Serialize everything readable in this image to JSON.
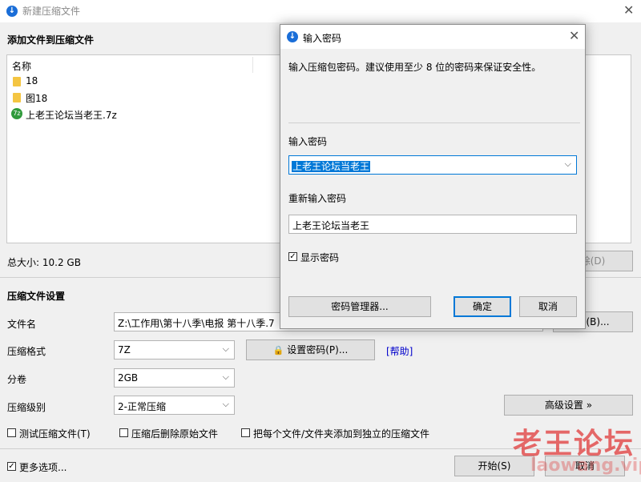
{
  "window": {
    "title": "新建压缩文件",
    "close": "✕"
  },
  "add_section": {
    "title": "添加文件到压缩文件",
    "column_header": "名称",
    "files": [
      {
        "name": "18",
        "icon": "folder-icon"
      },
      {
        "name": "图18",
        "icon": "folder-icon"
      },
      {
        "name": "上老王论坛当老王.7z",
        "icon": "archive-icon"
      }
    ],
    "total_size": "总大小: 10.2 GB",
    "remove_btn": "除(D)"
  },
  "settings": {
    "title": "压缩文件设置",
    "filename_label": "文件名",
    "filename_value": "Z:\\工作用\\第十八季\\电报 第十八季.7",
    "browse_btn": "览(B)...",
    "format_label": "压缩格式",
    "format_value": "7Z",
    "set_password_btn": "设置密码(P)...",
    "help_link": "[帮助]",
    "volume_label": "分卷",
    "volume_value": "2GB",
    "level_label": "压缩级别",
    "level_value": "2-正常压缩",
    "advanced_btn": "高级设置 »",
    "opt_test": "测试压缩文件(T)",
    "opt_delete": "压缩后删除原始文件",
    "opt_each": "把每个文件/文件夹添加到独立的压缩文件",
    "more_options": "更多选项...",
    "start_btn": "开始(S)",
    "cancel_btn": "取消"
  },
  "dialog": {
    "title": "输入密码",
    "description": "输入压缩包密码。建议使用至少 8 位的密码来保证安全性。",
    "password_label": "输入密码",
    "password_value": "上老王论坛当老王",
    "reenter_label": "重新输入密码",
    "reenter_value": "上老王论坛当老王",
    "show_password": "显示密码",
    "manager_btn": "密码管理器...",
    "ok_btn": "确定",
    "cancel_btn": "取消"
  },
  "watermark": {
    "line1": "老王论坛",
    "line2": "laowang.vip"
  },
  "colors": {
    "accent": "#0078d7",
    "link": "#0000cc",
    "watermark": "#e03a3a"
  }
}
